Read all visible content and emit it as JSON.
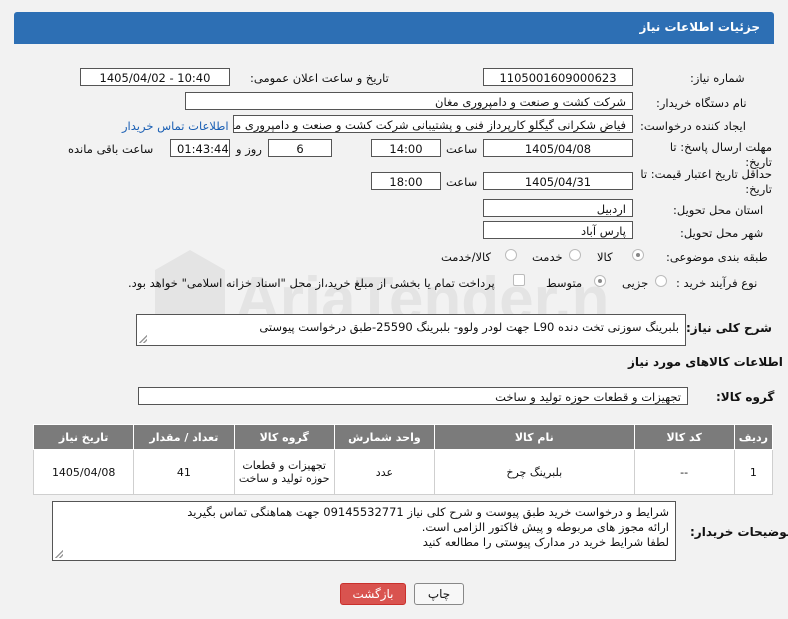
{
  "header": {
    "title": "جزئیات اطلاعات نیاز"
  },
  "fields": {
    "need_number_label": "شماره نیاز:",
    "need_number": "1105001609000623",
    "announce_label": "تاریخ و ساعت اعلان عمومی:",
    "announce_value": "1405/04/02 - 10:40",
    "buyer_org_label": "نام دستگاه خریدار:",
    "buyer_org": "شرکت کشت و صنعت و دامپروری مغان",
    "requester_label": "ایجاد کننده درخواست:",
    "requester": "فیاض شکرانی گیگلو کارپرداز فنی و پشتیبانی شرکت کشت و صنعت و دامپروری مغان",
    "contact_link": "اطلاعات تماس خریدار",
    "deadline_label": "مهلت ارسال پاسخ: تا تاریخ:",
    "deadline_date": "1405/04/08",
    "hour_label": "ساعت",
    "deadline_hour": "14:00",
    "days_value": "6",
    "days_label": "روز و",
    "remaining_time": "01:43:44",
    "remaining_label": "ساعت باقی مانده",
    "price_validity_label": "حداقل تاریخ اعتبار قیمت: تا تاریخ:",
    "price_validity_date": "1405/04/31",
    "price_validity_hour": "18:00",
    "province_label": "استان محل تحویل:",
    "province": "اردبیل",
    "city_label": "شهر محل تحویل:",
    "city": "پارس آباد",
    "category_label": "طبقه بندی موضوعی:",
    "category_options": [
      "کالا",
      "خدمت",
      "کالا/خدمت"
    ],
    "process_label": "نوع فرآیند خرید :",
    "process_options": [
      "جزیی",
      "متوسط"
    ],
    "payment_note": "پرداخت تمام یا بخشی از مبلغ خرید،از محل \"اسناد خزانه اسلامی\" خواهد بود."
  },
  "description": {
    "label": "شرح کلی نیاز:",
    "text": "بلبرینگ سوزنی تخت دنده L90 جهت لودر ولوو- بلبرینگ 25590-طبق درخواست پیوستی"
  },
  "goods_info_title": "اطلاعات کالاهای مورد نیاز",
  "goods_group": {
    "label": "گروه کالا:",
    "value": "تجهیزات و قطعات حوزه تولید و ساخت"
  },
  "table": {
    "headers": [
      "ردیف",
      "کد کالا",
      "نام کالا",
      "واحد شمارش",
      "گروه کالا",
      "تعداد / مقدار",
      "تاریخ نیاز"
    ],
    "rows": [
      [
        "1",
        "--",
        "بلبرینگ چرخ",
        "عدد",
        "تجهیزات و قطعات حوزه تولید و ساخت",
        "41",
        "1405/04/08"
      ]
    ]
  },
  "buyer_notes": {
    "label": "توضیحات خریدار:",
    "line1": "شرایط و درخواست خرید طبق پیوست و شرح کلی نیاز 09145532771 جهت هماهنگی تماس بگیرید",
    "line2": "ارائه مجوز های مربوطه و پیش فاکتور الزامی است.",
    "line3": "لطفا شرایط خرید در مدارک پیوستی را مطالعه کنید"
  },
  "buttons": {
    "print": "چاپ",
    "back": "بازگشت"
  },
  "watermark": "AriaTender.neT",
  "colors": {
    "header": "#2d6fb4",
    "link": "#1a5fb4",
    "back_button": "#d9534f"
  }
}
